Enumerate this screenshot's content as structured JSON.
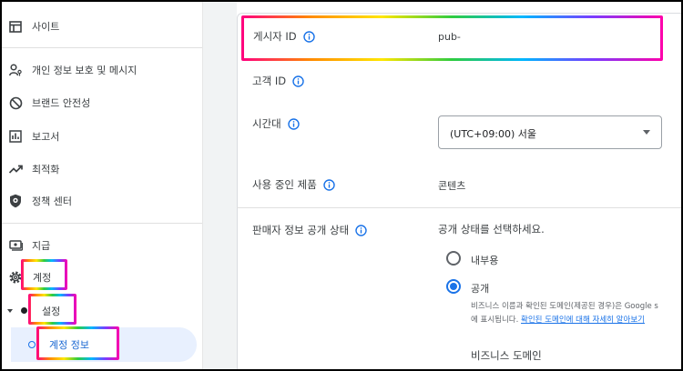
{
  "sidebar": {
    "items": [
      {
        "label": "사이트",
        "icon": "site-layout-icon"
      },
      {
        "label": "개인 정보 보호 및 메시지",
        "icon": "person-key-icon"
      },
      {
        "label": "브랜드 안전성",
        "icon": "block-icon"
      },
      {
        "label": "보고서",
        "icon": "bar-chart-icon"
      },
      {
        "label": "최적화",
        "icon": "trending-up-icon"
      },
      {
        "label": "정책 센터",
        "icon": "shield-icon"
      },
      {
        "label": "지급",
        "icon": "payments-icon"
      },
      {
        "label": "계정",
        "icon": "gear-icon"
      },
      {
        "label": "설정",
        "icon": "dot-icon"
      },
      {
        "label": "계정 정보",
        "icon": "circle-outline-icon"
      }
    ]
  },
  "main": {
    "publisher_id": {
      "label": "게시자 ID",
      "value": "pub-"
    },
    "customer_id": {
      "label": "고객 ID",
      "value": ""
    },
    "timezone": {
      "label": "시간대",
      "value": "(UTC+09:00) 서울"
    },
    "products": {
      "label": "사용 중인 제품",
      "value": "콘텐츠"
    },
    "seller_info": {
      "label": "판매자 정보 공개 상태",
      "prompt": "공개 상태를 선택하세요.",
      "options": [
        {
          "label": "내부용",
          "selected": false
        },
        {
          "label": "공개",
          "selected": true
        }
      ],
      "public_desc_line1": "비즈니스 이름과 확인된 도메인(제공된 경우)은 Google s",
      "public_desc_line2_prefix": "에 표시됩니다.",
      "public_desc_link": "확인된 도메인에 대해 자세히 알아보기",
      "business_domain_label": "비즈니스 도메인"
    }
  },
  "colors": {
    "accent": "#1a73e8",
    "highlight_pink": "#ff0080"
  }
}
